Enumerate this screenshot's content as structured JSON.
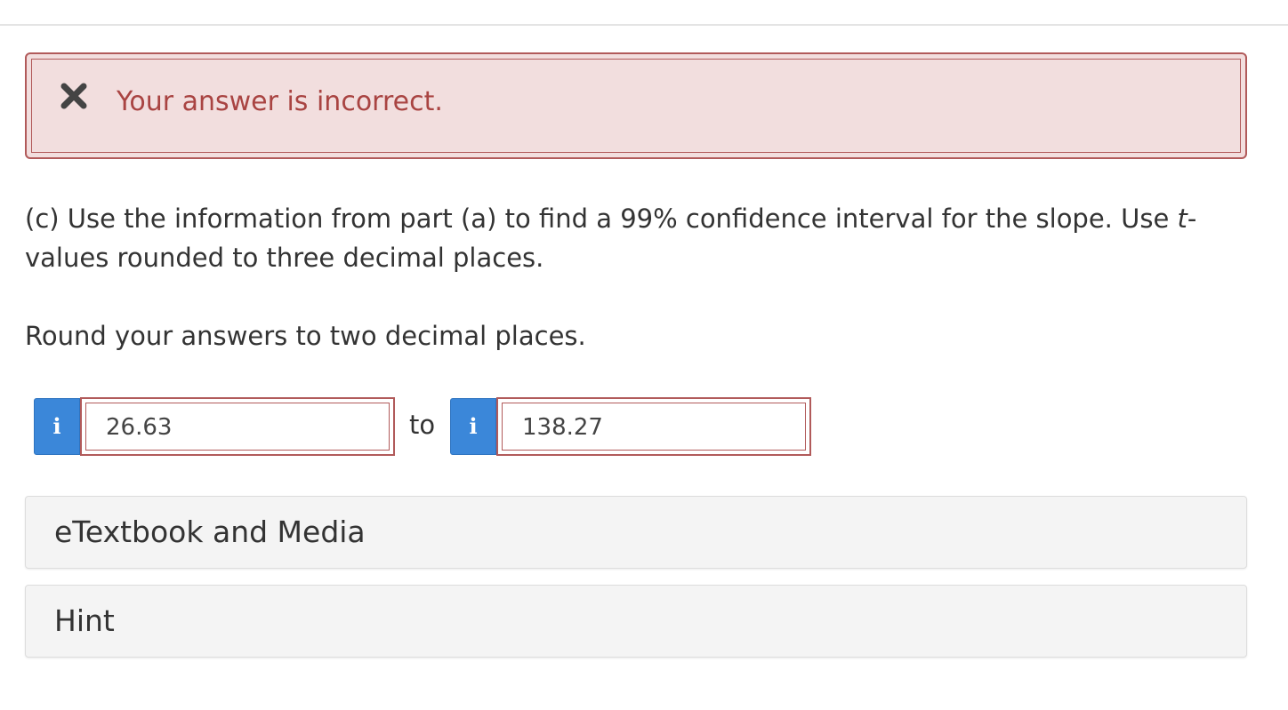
{
  "feedback": {
    "message": "Your answer is incorrect.",
    "icon": "close-icon",
    "color": "#a94442",
    "background": "#f2dede"
  },
  "question": {
    "text_before": "(c) Use the information from part (a) to find a 99% confidence interval for the slope. Use ",
    "italic_term": "t",
    "text_after": "-values rounded to three decimal places."
  },
  "instruction": "Round your answers to two decimal places.",
  "answers": {
    "lower": {
      "info_label": "i",
      "value": "26.63"
    },
    "separator": "to",
    "upper": {
      "info_label": "i",
      "value": "138.27"
    }
  },
  "panels": {
    "etextbook": "eTextbook and Media",
    "hint": "Hint"
  },
  "colors": {
    "info_button": "#3b87d9",
    "error_border": "#b15a5a",
    "panel_background": "#f4f4f4"
  }
}
